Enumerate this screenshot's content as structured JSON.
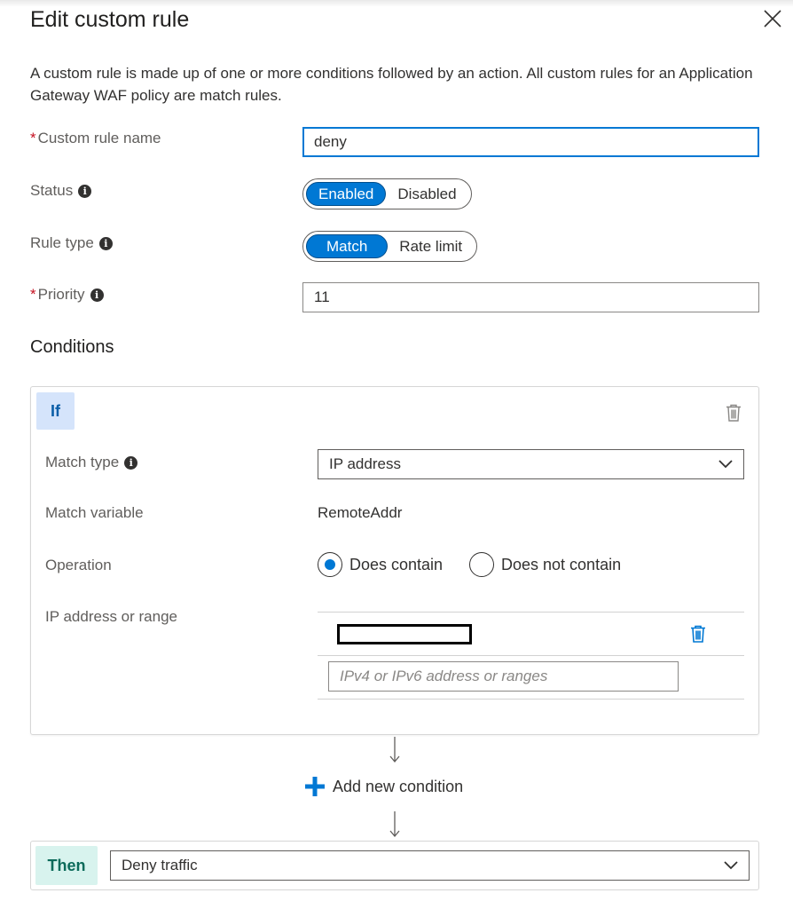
{
  "panel": {
    "title": "Edit custom rule",
    "description": "A custom rule is made up of one or more conditions followed by an action. All custom rules for an Application Gateway WAF policy are match rules."
  },
  "form": {
    "rule_name_label": "Custom rule name",
    "rule_name_value": "deny",
    "status_label": "Status",
    "status_options": [
      "Enabled",
      "Disabled"
    ],
    "status_selected": "Enabled",
    "rule_type_label": "Rule type",
    "rule_type_options": [
      "Match",
      "Rate limit"
    ],
    "rule_type_selected": "Match",
    "priority_label": "Priority",
    "priority_value": "11",
    "required_mark": "*"
  },
  "conditions": {
    "heading": "Conditions",
    "if_label": "If",
    "match_type_label": "Match type",
    "match_type_value": "IP address",
    "match_variable_label": "Match variable",
    "match_variable_value": "RemoteAddr",
    "operation_label": "Operation",
    "operation_options": [
      "Does contain",
      "Does not contain"
    ],
    "operation_selected": "Does contain",
    "ip_label": "IP address or range",
    "ip_placeholder": "IPv4 or IPv6 address or ranges",
    "add_condition_label": "Add new condition"
  },
  "action": {
    "then_label": "Then",
    "value": "Deny traffic"
  },
  "colors": {
    "accent": "#0078d4",
    "if_badge_bg": "#d5e4fb",
    "then_badge_bg": "#d8f3ee",
    "required": "#c50f1f"
  }
}
